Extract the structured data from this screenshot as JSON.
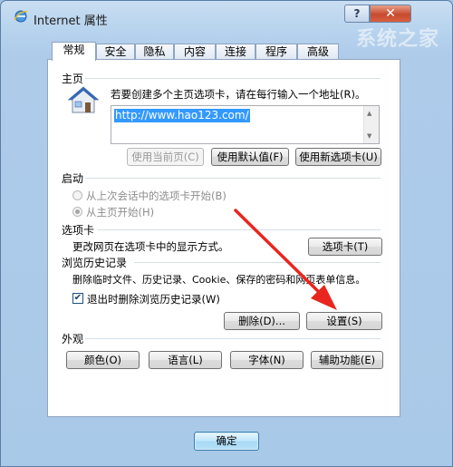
{
  "window": {
    "title": "Internet 属性",
    "help": "?",
    "close": "✕",
    "watermark": "系统之家"
  },
  "tabs": [
    {
      "label": "常规",
      "active": true
    },
    {
      "label": "安全"
    },
    {
      "label": "隐私"
    },
    {
      "label": "内容"
    },
    {
      "label": "连接"
    },
    {
      "label": "程序"
    },
    {
      "label": "高级"
    }
  ],
  "home": {
    "title": "主页",
    "instruction": "若要创建多个主页选项卡，请在每行输入一个地址(R)。",
    "url": "http://www.hao123.com/",
    "use_current": "使用当前页(C)",
    "use_default": "使用默认值(F)",
    "use_new_tab": "使用新选项卡(U)"
  },
  "startup": {
    "title": "启动",
    "option_last_session": "从上次会话中的选项卡开始(B)",
    "option_home": "从主页开始(H)"
  },
  "tabs_section": {
    "title": "选项卡",
    "desc": "更改网页在选项卡中的显示方式。",
    "button": "选项卡(T)"
  },
  "history": {
    "title": "浏览历史记录",
    "desc": "删除临时文件、历史记录、Cookie、保存的密码和网页表单信息。",
    "checkbox_label": "退出时删除浏览历史记录(W)",
    "checkbox_checked": true,
    "delete_button": "删除(D)...",
    "settings_button": "设置(S)"
  },
  "appearance": {
    "title": "外观",
    "colors": "颜色(O)",
    "languages": "语言(L)",
    "fonts": "字体(N)",
    "accessibility": "辅助功能(E)"
  },
  "footer": {
    "ok": "确定"
  },
  "colors": {
    "arrow": "#e8261e",
    "selection": "#3399ff"
  }
}
